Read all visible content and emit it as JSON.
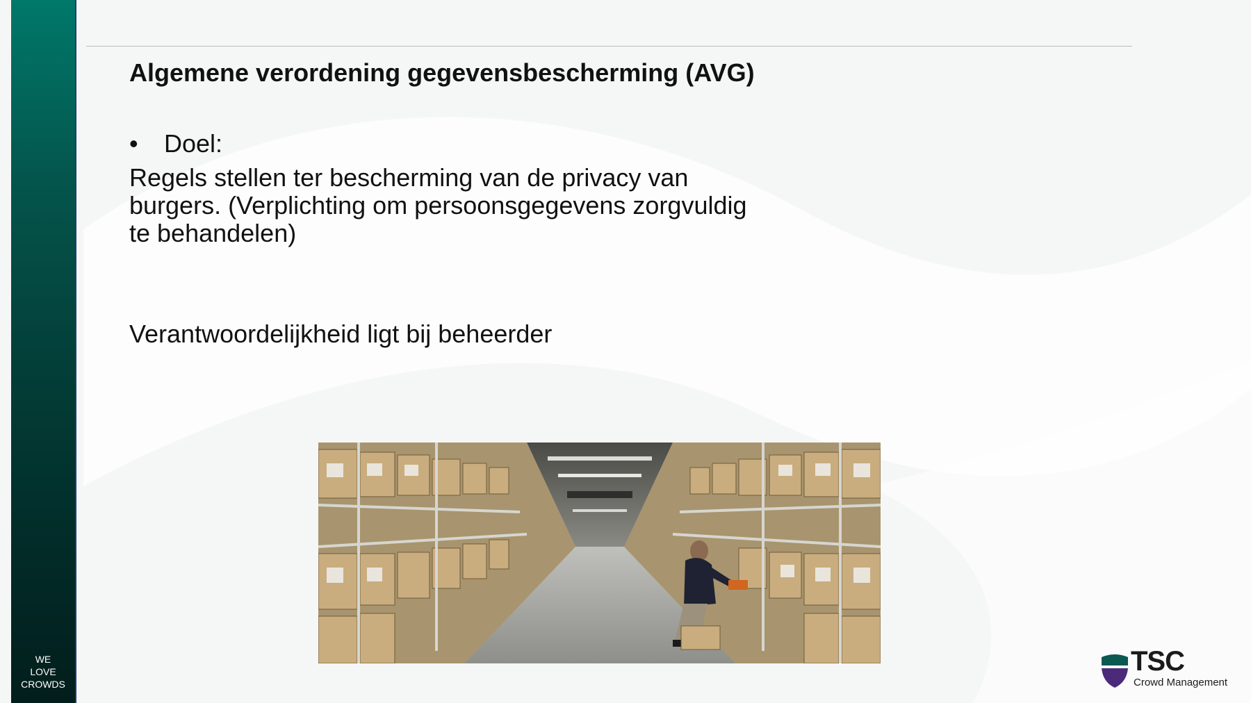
{
  "slide": {
    "title": "Algemene verordening gegevensbescherming (AVG)",
    "bullet_marker": "•",
    "bullet_label": "Doel:",
    "body_lines": [
      "Regels stellen ter bescherming van de privacy van",
      "burgers. (Verplichting om persoonsgegevens zorgvuldig",
      "te behandelen)"
    ],
    "responsibility": "Verantwoordelijkheid ligt bij beheerder"
  },
  "sidebar": {
    "slogan_lines": [
      "WE",
      "LOVE",
      "CROWDS"
    ]
  },
  "logo": {
    "name": "TSC",
    "subtitle": "Crowd Management"
  },
  "image": {
    "subject": "archive warehouse with shelves of boxes and a person lifting a box"
  },
  "colors": {
    "sidebar_top": "#00786a",
    "sidebar_bottom": "#021e1c",
    "sidebar_edge": "#1f3a78",
    "logo_shield_green": "#0b5a52",
    "logo_shield_purple": "#4b2a7a",
    "background": "#f5f6f6"
  }
}
